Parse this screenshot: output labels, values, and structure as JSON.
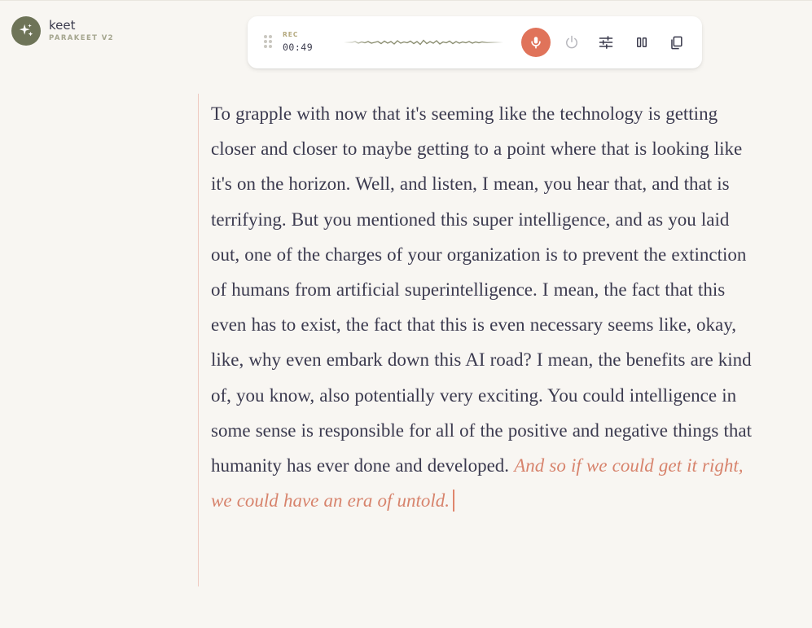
{
  "app": {
    "name": "keet",
    "model": "PARAKEET V2",
    "icon": "sparkles-icon"
  },
  "toolbar": {
    "rec_label": "REC",
    "rec_time": "00:49",
    "buttons": [
      {
        "name": "mic-button",
        "icon": "microphone-icon",
        "state": "active"
      },
      {
        "name": "power-button",
        "icon": "power-icon"
      },
      {
        "name": "settings-button",
        "icon": "sliders-icon"
      },
      {
        "name": "columns-button",
        "icon": "pause-columns-icon"
      },
      {
        "name": "copy-button",
        "icon": "copy-icon"
      }
    ]
  },
  "transcript": {
    "final_text": "To grapple with now that it's seeming like the technology is getting closer and closer to maybe getting to a point where that is looking like it's on the horizon. Well, and listen, I mean, you hear that, and that is terrifying. But you mentioned this super intelligence, and as you laid out, one of the charges of your organization is to prevent the extinction of humans from artificial superintelligence. I mean, the fact that this even has to exist, the fact that this is even necessary seems like, okay, like, why even embark down this AI road? I mean, the benefits are kind of, you know, also potentially very exciting. You could intelligence in some sense is responsible for all of the positive and negative things that humanity has ever done and developed.",
    "partial_text": "And so if we could get it right, we could have an era of untold."
  },
  "colors": {
    "accent": "#e0735a",
    "logo_bg": "#6e7458",
    "background": "#f8f6f2",
    "partial_text": "#d7836c",
    "body_text": "#3b3a4f"
  }
}
